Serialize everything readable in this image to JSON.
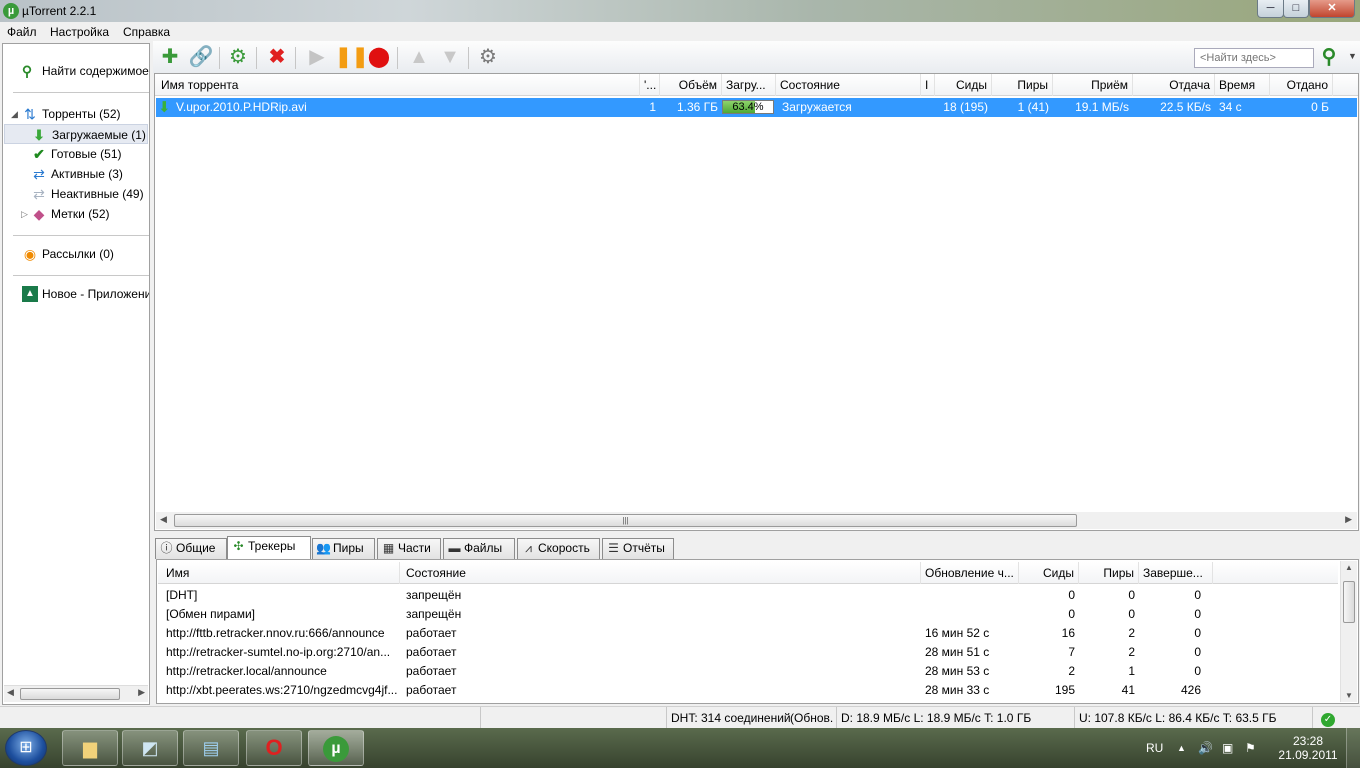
{
  "window": {
    "title": "µTorrent 2.2.1",
    "logo": "µ",
    "min": "─",
    "max": "□",
    "close": "✕"
  },
  "menu": [
    "Файл",
    "Настройка",
    "Справка"
  ],
  "sidebar": {
    "find": "Найти содержимое",
    "torrents": "Торренты (52)",
    "downloading": "Загружаемые (1)",
    "completed": "Готовые (51)",
    "active": "Активные (3)",
    "inactive": "Неактивные (49)",
    "labels": "Метки (52)",
    "feeds": "Рассылки (0)",
    "apps": "Новое - Приложени"
  },
  "search": {
    "placeholder": "<Найти здесь>"
  },
  "colors": {
    "selection": "#3399ff",
    "progress": "#4fa836",
    "delete": "#e02020",
    "pause": "#f39c12",
    "stop": "#e01010"
  },
  "torrent_headers": [
    "Имя торрента",
    "'...",
    "Объём",
    "Загру...",
    "Состояние",
    "I",
    "Сиды",
    "Пиры",
    "Приём",
    "Отдача",
    "Время",
    "Отдано"
  ],
  "torrent": {
    "name": "V.upor.2010.P.HDRip.avi",
    "num": "1",
    "size": "1.36 ГБ",
    "progress": 63.4,
    "progress_label": "63.4%",
    "status": "Загружается",
    "seeds": "18 (195)",
    "peers": "1 (41)",
    "down": "19.1 МБ/s",
    "up": "22.5 КБ/s",
    "eta": "34 с",
    "uploaded": "0 Б"
  },
  "tabs": [
    "Общие",
    "Трекеры",
    "Пиры",
    "Части",
    "Файлы",
    "Скорость",
    "Отчёты"
  ],
  "tracker_headers": [
    "Имя",
    "Состояние",
    "Обновление ч...",
    "Сиды",
    "Пиры",
    "Заверше..."
  ],
  "trackers": [
    {
      "name": "[DHT]",
      "status": "запрещён",
      "update": "",
      "seeds": "0",
      "peers": "0",
      "done": "0"
    },
    {
      "name": "[Обмен пирами]",
      "status": "запрещён",
      "update": "",
      "seeds": "0",
      "peers": "0",
      "done": "0"
    },
    {
      "name": "http://fttb.retracker.nnov.ru:666/announce",
      "status": "работает",
      "update": "16 мин 52 с",
      "seeds": "16",
      "peers": "2",
      "done": "0"
    },
    {
      "name": "http://retracker-sumtel.no-ip.org:2710/an...",
      "status": "работает",
      "update": "28 мин 51 с",
      "seeds": "7",
      "peers": "2",
      "done": "0"
    },
    {
      "name": "http://retracker.local/announce",
      "status": "работает",
      "update": "28 мин 53 с",
      "seeds": "2",
      "peers": "1",
      "done": "0"
    },
    {
      "name": "http://xbt.peerates.ws:2710/ngzedmcvg4jf...",
      "status": "работает",
      "update": "28 мин 33 с",
      "seeds": "195",
      "peers": "41",
      "done": "426"
    }
  ],
  "status": {
    "dht": "DHT: 314 соединений",
    "update": "(Обнов.",
    "down": "D: 18.9 МБ/с L: 18.9 МБ/с T: 1.0 ГБ",
    "up": "U: 107.8 КБ/с L: 86.4 КБ/с T: 63.5 ГБ"
  },
  "taskbar": {
    "lang": "RU",
    "time": "23:28",
    "date": "21.09.2011"
  }
}
